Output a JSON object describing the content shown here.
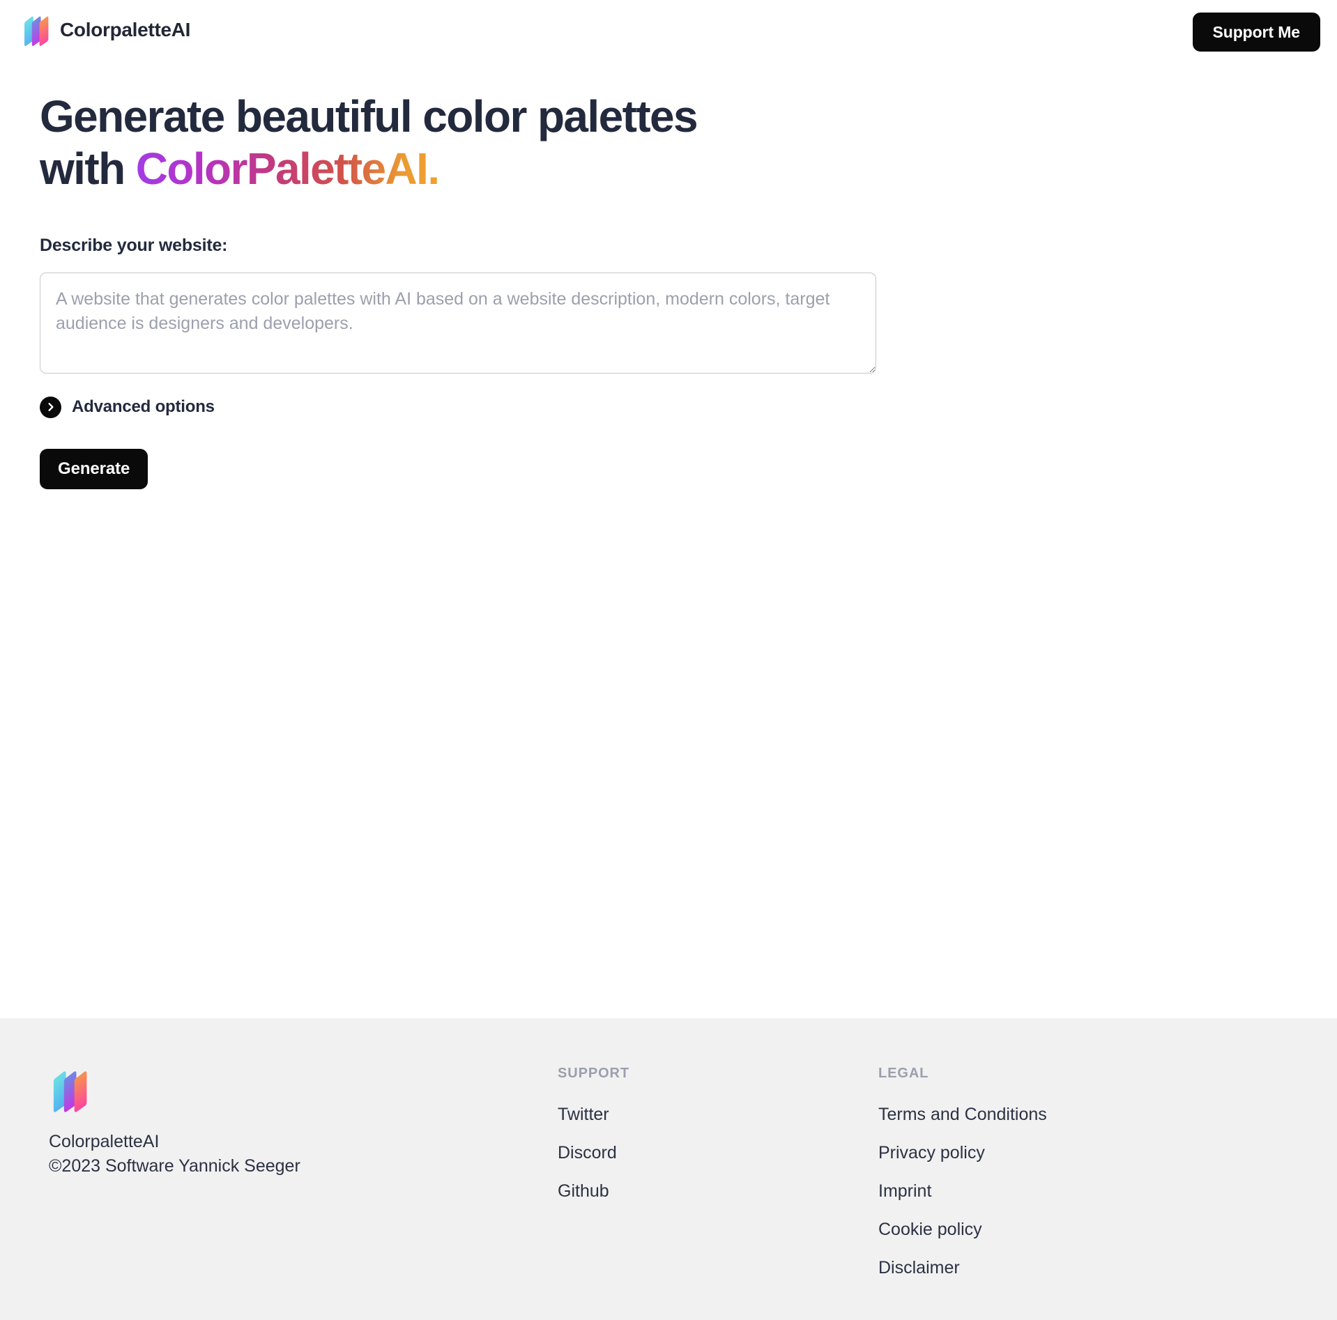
{
  "header": {
    "brand_name": "ColorpaletteAI",
    "logo_icon": "colorpalette-logo-icon",
    "support_button_label": "Support Me"
  },
  "hero": {
    "heading_line1": "Generate beautiful color palettes",
    "heading_line2_prefix": "with ",
    "heading_line2_gradient": "ColorPaletteAI.",
    "gradient_start": "#a23ce4",
    "gradient_mid": "#c2397f",
    "gradient_end": "#efa22e"
  },
  "form": {
    "describe_label": "Describe your website:",
    "textarea_value": "",
    "textarea_placeholder": "A website that generates color palettes with AI based on a website description, modern colors, target audience is designers and developers.",
    "advanced_options_label": "Advanced options",
    "advanced_options_icon": "chevron-right-icon",
    "generate_button_label": "Generate"
  },
  "footer": {
    "logo_icon": "colorpalette-logo-icon",
    "brand_name": "ColorpaletteAI",
    "copyright": "©2023 Software Yannick Seeger",
    "columns": [
      {
        "title": "SUPPORT",
        "links": [
          {
            "label": "Twitter"
          },
          {
            "label": "Discord"
          },
          {
            "label": "Github"
          }
        ]
      },
      {
        "title": "LEGAL",
        "links": [
          {
            "label": "Terms and Conditions"
          },
          {
            "label": "Privacy policy"
          },
          {
            "label": "Imprint"
          },
          {
            "label": "Cookie policy"
          },
          {
            "label": "Disclaimer"
          }
        ]
      }
    ],
    "background_color": "#f1f1f2"
  }
}
